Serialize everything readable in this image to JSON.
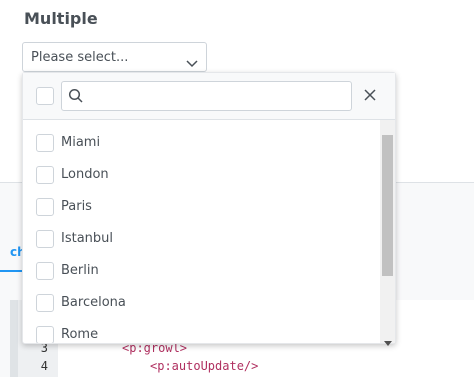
{
  "heading": "Multiple",
  "select": {
    "label": "Please select..."
  },
  "background": {
    "tab_label": "ch",
    "code_lines": [
      {
        "num": "3",
        "text": "<p:growl>"
      },
      {
        "num": "4",
        "text": "<p:autoUpdate/>"
      }
    ]
  },
  "panel": {
    "search_placeholder": "",
    "items": [
      "Miami",
      "London",
      "Paris",
      "Istanbul",
      "Berlin",
      "Barcelona",
      "Rome"
    ]
  },
  "colors": {
    "accent": "#2196f3",
    "border": "#ced4da",
    "text": "#495057"
  }
}
